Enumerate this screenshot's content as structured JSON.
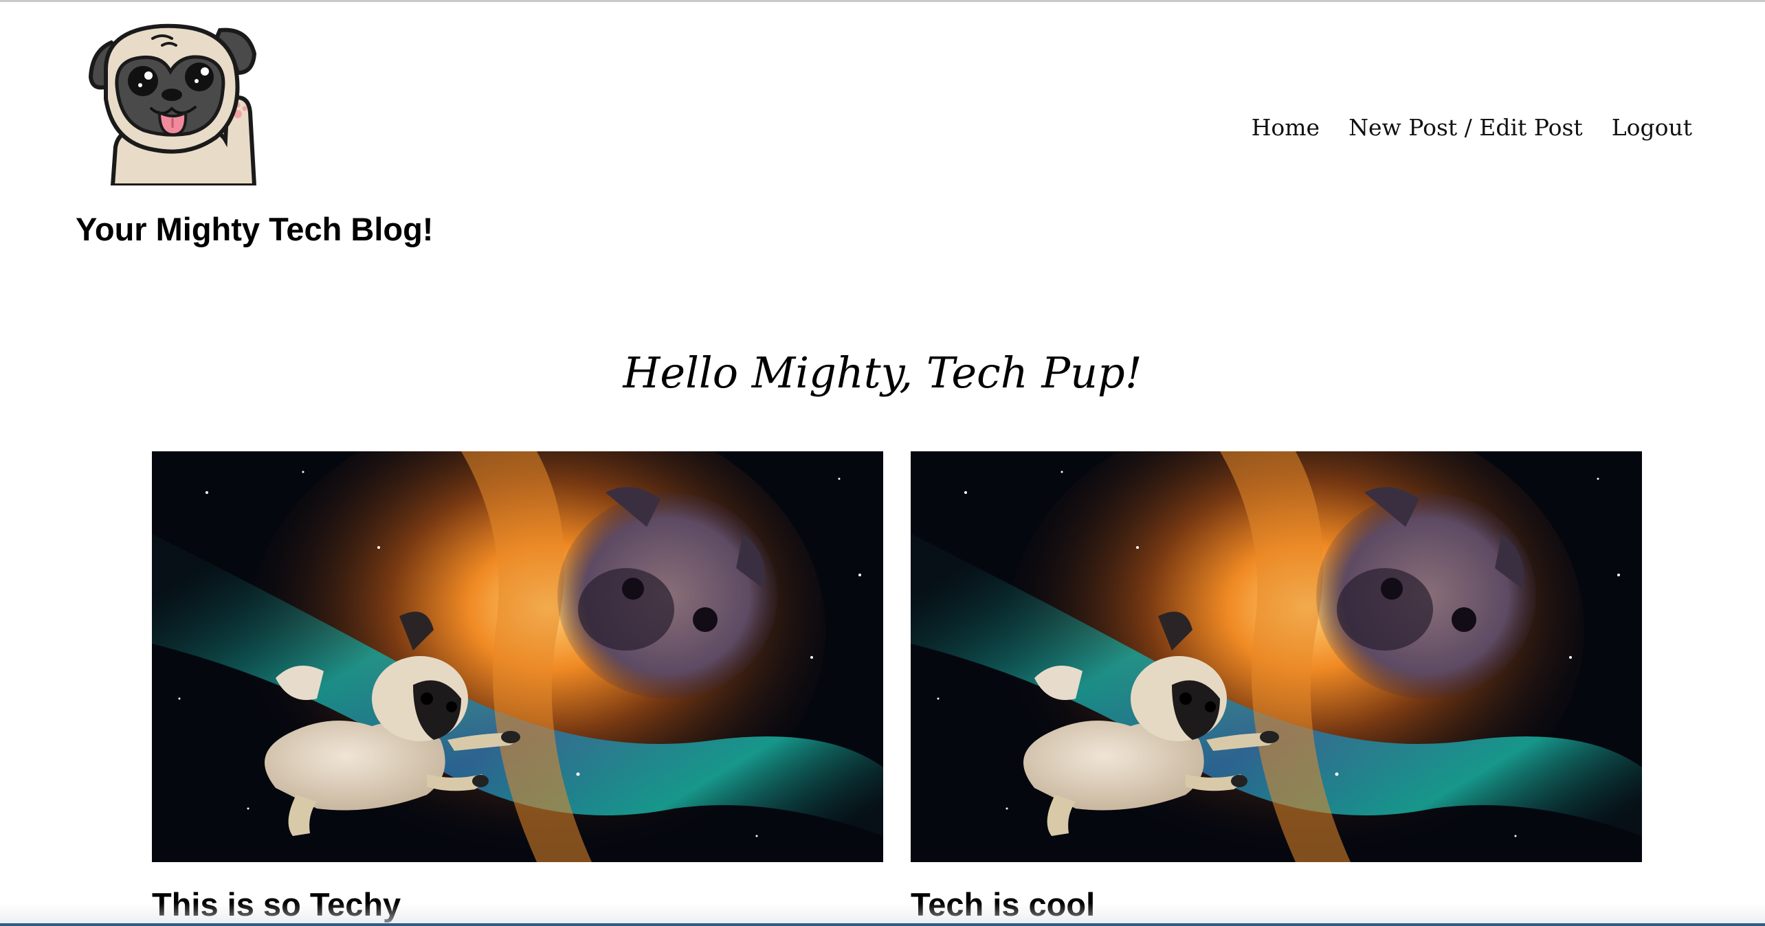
{
  "header": {
    "site_title": "Your Mighty Tech Blog!",
    "logo_icon": "pug-waving-logo"
  },
  "nav": {
    "items": [
      {
        "label": "Home"
      },
      {
        "label": "New Post / Edit Post"
      },
      {
        "label": "Logout"
      }
    ]
  },
  "main": {
    "greeting": "Hello Mighty, Tech Pup!"
  },
  "posts": [
    {
      "title": "This is so Techy",
      "image": "space-pug-nebula"
    },
    {
      "title": "Tech is cool",
      "image": "space-pug-nebula"
    }
  ],
  "colors": {
    "pug_fur": "#e8dcc8",
    "pug_mask": "#4a4a4a",
    "tongue": "#f08a9c",
    "paw_pad": "#f3a3a3",
    "outline": "#1a1a1a"
  }
}
